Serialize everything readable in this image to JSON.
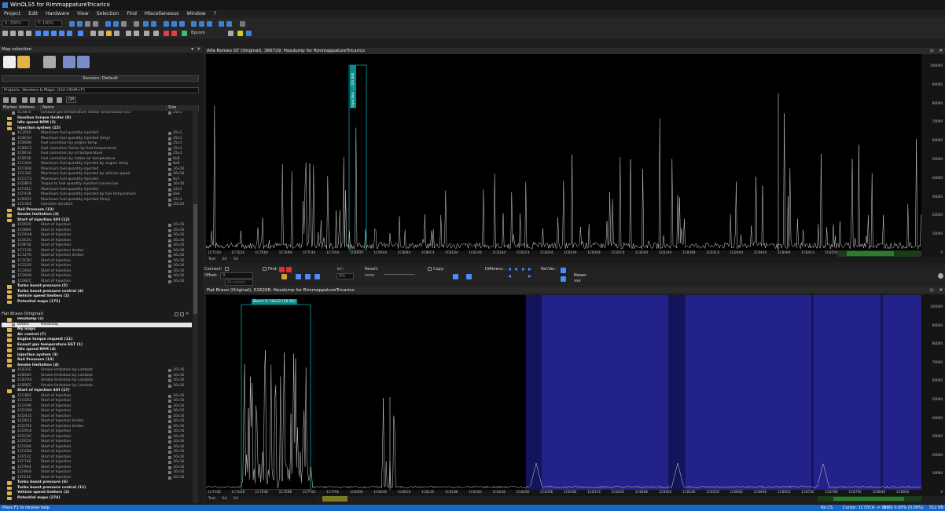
{
  "app_title": "WinOLS5 for RimmappatureTricarico",
  "menu": [
    "Project",
    "Edit",
    "Hardware",
    "View",
    "Selection",
    "Find",
    "Miscellaneous",
    "Window",
    "?"
  ],
  "toolbar": {
    "zoom_x": "X: 200%",
    "zoom_y": "Y: 100%",
    "bit_label": "8 bit",
    "bprom_label": "Bprom"
  },
  "map_selection": {
    "title": "Map selection",
    "session": "Session: Default",
    "project_combo": "Projects, Versions & Maps: (Ctrl+Shift+F)",
    "filter_off": "Off"
  },
  "columns": [
    "Marker",
    "Address",
    "Name",
    "Size"
  ],
  "tree_top": [
    {
      "k": "map",
      "addr": "1C44F0",
      "name": "Exhaust gas temperature sensor linearisation EGT",
      "size": "25x1",
      "cut": true
    },
    {
      "k": "folder",
      "text": "Gearbox torque limiter (8)"
    },
    {
      "k": "folder",
      "text": "Idle speed RPM (2)"
    },
    {
      "k": "folder-open",
      "text": "Injection system (15)"
    },
    {
      "k": "map",
      "addr": "1C25E6",
      "name": "Maximum fuel quantity injected",
      "size": "25x1"
    },
    {
      "k": "map",
      "addr": "1C8C0A",
      "name": "Maximum fuel quantity injected (limp)",
      "size": "25x1"
    },
    {
      "k": "map",
      "addr": "1CB698",
      "name": "Fuel correction by engine temp",
      "size": "25x1"
    },
    {
      "k": "map",
      "addr": "1CB6C2",
      "name": "Fuel correction factor by fuel temperature",
      "size": "25x1"
    },
    {
      "k": "map",
      "addr": "1CBF34",
      "name": "Fuel correction by oil temperature",
      "size": "25x1"
    },
    {
      "k": "map",
      "addr": "1CBF6E",
      "name": "Fuel correction by intake air temperature",
      "size": "8x8"
    },
    {
      "k": "map",
      "addr": "1CC03A",
      "name": "Maximum fuel quantity injected by engine temp",
      "size": "8x8"
    },
    {
      "k": "map",
      "addr": "1CC0F8",
      "name": "Maximum fuel quantity injected",
      "size": "16x16"
    },
    {
      "k": "map",
      "addr": "1CC33C",
      "name": "Maximum fuel quantity injected by vehicle speed",
      "size": "16x16"
    },
    {
      "k": "map",
      "addr": "1CCC72",
      "name": "Maximum fuel quantity injected",
      "size": "6x1"
    },
    {
      "k": "map",
      "addr": "1CDBF6",
      "name": "Torque to fuel quantity injected conversion",
      "size": "16x16"
    },
    {
      "k": "map",
      "addr": "1CF3EC",
      "name": "Maximum fuel quantity injected",
      "size": "12x1"
    },
    {
      "k": "map",
      "addr": "1CF438",
      "name": "Maximum fuel quantity injected by fuel temperature",
      "size": "8x8"
    },
    {
      "k": "map",
      "addr": "1CB922",
      "name": "Maximum fuel quantity injected (limp)",
      "size": "12x1"
    },
    {
      "k": "map",
      "addr": "1CE3DE",
      "name": "Injection duration",
      "size": "20x20"
    },
    {
      "k": "folder",
      "text": "Rail Pressure (13)"
    },
    {
      "k": "folder",
      "text": "Smoke limitation (3)"
    },
    {
      "k": "folder-open",
      "text": "Start of injection SOI (12)"
    },
    {
      "k": "map",
      "addr": "1C0620",
      "name": "Start of Injection",
      "size": "16x16"
    },
    {
      "k": "map",
      "addr": "1C0864",
      "name": "Start of Injection",
      "size": "16x16"
    },
    {
      "k": "map",
      "addr": "1C0AA8",
      "name": "Start of Injection",
      "size": "16x16"
    },
    {
      "k": "map",
      "addr": "1C0CEC",
      "name": "Start of Injection",
      "size": "16x16"
    },
    {
      "k": "map",
      "addr": "1C0F30",
      "name": "Start of Injection",
      "size": "16x16"
    },
    {
      "k": "map",
      "addr": "1C1130",
      "name": "Start of Injection limiter",
      "size": "16x16"
    },
    {
      "k": "map",
      "addr": "1C1270",
      "name": "Start of Injection limiter",
      "size": "16x16"
    },
    {
      "k": "map",
      "addr": "1C1FDC",
      "name": "Start of Injection",
      "size": "16x16"
    },
    {
      "k": "map",
      "addr": "1C2220",
      "name": "Start of Injection",
      "size": "16x16"
    },
    {
      "k": "map",
      "addr": "1C2464",
      "name": "Start of Injection",
      "size": "16x16"
    },
    {
      "k": "map",
      "addr": "1C26A8",
      "name": "Start of Injection",
      "size": "16x16"
    },
    {
      "k": "map",
      "addr": "1C08EC",
      "name": "Start of Injection",
      "size": "16x16"
    },
    {
      "k": "folder",
      "text": "Turbo boost pressure (5)"
    },
    {
      "k": "folder",
      "text": "Turbo boost pressure control (4)"
    },
    {
      "k": "folder",
      "text": "Vehicle speed limiters (2)"
    },
    {
      "k": "folder",
      "text": "Potential maps (172)"
    }
  ],
  "fiat_header": "Fiat Bravo (Original)",
  "tree_bottom": [
    {
      "k": "folder-open",
      "text": "Hexdump (1)"
    },
    {
      "k": "sel",
      "addr": "00000",
      "name": "Hexdump"
    },
    {
      "k": "folder",
      "text": "My maps"
    },
    {
      "k": "folder",
      "text": "Air control (7)"
    },
    {
      "k": "folder",
      "text": "Engine torque request (11)"
    },
    {
      "k": "folder",
      "text": "Exaust gas temperature EGT (1)"
    },
    {
      "k": "folder",
      "text": "Idle speed RPM (4)"
    },
    {
      "k": "folder",
      "text": "Injection system (3)"
    },
    {
      "k": "folder",
      "text": "Rail Pressure (13)"
    },
    {
      "k": "folder-open",
      "text": "Smoke limitation (4)"
    },
    {
      "k": "map",
      "addr": "1CB31E",
      "name": "Smoke limitation by Lambda",
      "size": "16x16"
    },
    {
      "k": "map",
      "addr": "1CB562",
      "name": "Smoke limitation by Lambda",
      "size": "16x16"
    },
    {
      "k": "map",
      "addr": "1CB7AA",
      "name": "Smoke limitation by Lambda",
      "size": "16x16"
    },
    {
      "k": "map",
      "addr": "1CB9EE",
      "name": "Smoke limitation by Lambda",
      "size": "16x16"
    },
    {
      "k": "folder-open",
      "text": "Start of injection SOI (17)"
    },
    {
      "k": "map",
      "addr": "1CCB0E",
      "name": "Start of Injection",
      "size": "16x16"
    },
    {
      "k": "map",
      "addr": "1CCD52",
      "name": "Start of Injection",
      "size": "16x16"
    },
    {
      "k": "map",
      "addr": "1CCF96",
      "name": "Start of Injection",
      "size": "16x16"
    },
    {
      "k": "map",
      "addr": "1CD1DA",
      "name": "Start of Injection",
      "size": "16x16"
    },
    {
      "k": "map",
      "addr": "1CD41E",
      "name": "Start of Injection",
      "size": "16x16"
    },
    {
      "k": "map",
      "addr": "1CD61E",
      "name": "Start of Injection limiter",
      "size": "16x16"
    },
    {
      "k": "map",
      "addr": "1CD75E",
      "name": "Start of Injection limiter",
      "size": "16x16"
    },
    {
      "k": "map",
      "addr": "1CE9C8",
      "name": "Start of Injection",
      "size": "16x16"
    },
    {
      "k": "map",
      "addr": "1CEC0C",
      "name": "Start of Injection",
      "size": "16x16"
    },
    {
      "k": "map",
      "addr": "1CEE50",
      "name": "Start of Injection",
      "size": "16x16"
    },
    {
      "k": "map",
      "addr": "1CF094",
      "name": "Start of Injection",
      "size": "16x16"
    },
    {
      "k": "map",
      "addr": "1CF2D8",
      "name": "Start of Injection",
      "size": "16x16"
    },
    {
      "k": "map",
      "addr": "1CF51C",
      "name": "Start of Injection",
      "size": "16x16"
    },
    {
      "k": "map",
      "addr": "1CF760",
      "name": "Start of Injection",
      "size": "16x16"
    },
    {
      "k": "map",
      "addr": "1CF9A4",
      "name": "Start of Injection",
      "size": "16x16"
    },
    {
      "k": "map",
      "addr": "1CFBE8",
      "name": "Start of Injection",
      "size": "16x16"
    },
    {
      "k": "map",
      "addr": "1CFE2C",
      "name": "Start of Injection",
      "size": "16x16"
    },
    {
      "k": "folder",
      "text": "Turbo boost pressure (6)"
    },
    {
      "k": "folder",
      "text": "Turbo boost pressure control (11)"
    },
    {
      "k": "folder",
      "text": "Vehicle speed limiters (2)"
    },
    {
      "k": "folder",
      "text": "Potential maps (274)"
    }
  ],
  "top_window": {
    "title": "Alfa Romeo GT (Original), 386729, Hexdump for RimmappatureTricarico",
    "map_tag": "Injection ... (16 Bit)",
    "xlabels": [
      "1C7C0A",
      "1C7E24",
      "1C7E6A",
      "1C7EB0",
      "1C7F44",
      "1C7FA4",
      "1C8004",
      "1C8044",
      "1C8084",
      "1C80C4",
      "1C8104",
      "1C8144",
      "1C8184",
      "1C81C4",
      "1C8204",
      "1C8244",
      "1C8284",
      "1C82C4",
      "1C8304",
      "1C8344",
      "1C8384",
      "1C83C4",
      "1C8404",
      "1C8444",
      "1C8484",
      "1C84C4",
      "1C8504",
      "1C8544",
      "1C8584",
      "1C85C4"
    ]
  },
  "bottom_window": {
    "title": "Fiat Bravo (Original), 516208, Hexdump for RimmappatureTricarico",
    "map_tag": "Bosch II: 16x12 (16 Bit)",
    "xlabels": [
      "1C7C0E",
      "1C7D2E",
      "1C7E4E",
      "1C7EBE",
      "1C7F0E",
      "1C7FAE",
      "1C800E",
      "1C804E",
      "1C80CE",
      "1C812E",
      "1C818E",
      "1C81EE",
      "1C824E",
      "1C82AE",
      "1C830E",
      "1C836E",
      "1C83CE",
      "1C842E",
      "1C848E",
      "1C84EE",
      "1C854E",
      "1C85AE",
      "1C860E",
      "1C866E",
      "1C86CE",
      "1C872E",
      "1C878E",
      "1C87EE",
      "1C884E",
      "1C88AE"
    ]
  },
  "yaxis": [
    "100000",
    "90000",
    "80000",
    "70000",
    "60000",
    "50000",
    "40000",
    "30000",
    "20000",
    "10000",
    "0"
  ],
  "view_tabs": [
    "Text",
    "2d",
    "3d"
  ],
  "midbar": {
    "connect": "Connect:",
    "offset": "Offset:",
    "offset_value": "0",
    "at_cursor": "At cursor",
    "find": "Find:",
    "plusminus": "+/-:",
    "percent": "0%",
    "result": "Result:",
    "result_value": "none",
    "copy": "Copy:",
    "difference": "Differenc...",
    "refver": "Ref.Ver.:",
    "newer": "Newer",
    "newer_sub": "vvv"
  },
  "status": {
    "left": "Press F1 to receive help.",
    "cs": "No CS",
    "cursor": "Cursor: 1C7DCA -> 0x0",
    "values": "0 (0) 0.00% (0.00%)",
    "size": "512 KB"
  }
}
